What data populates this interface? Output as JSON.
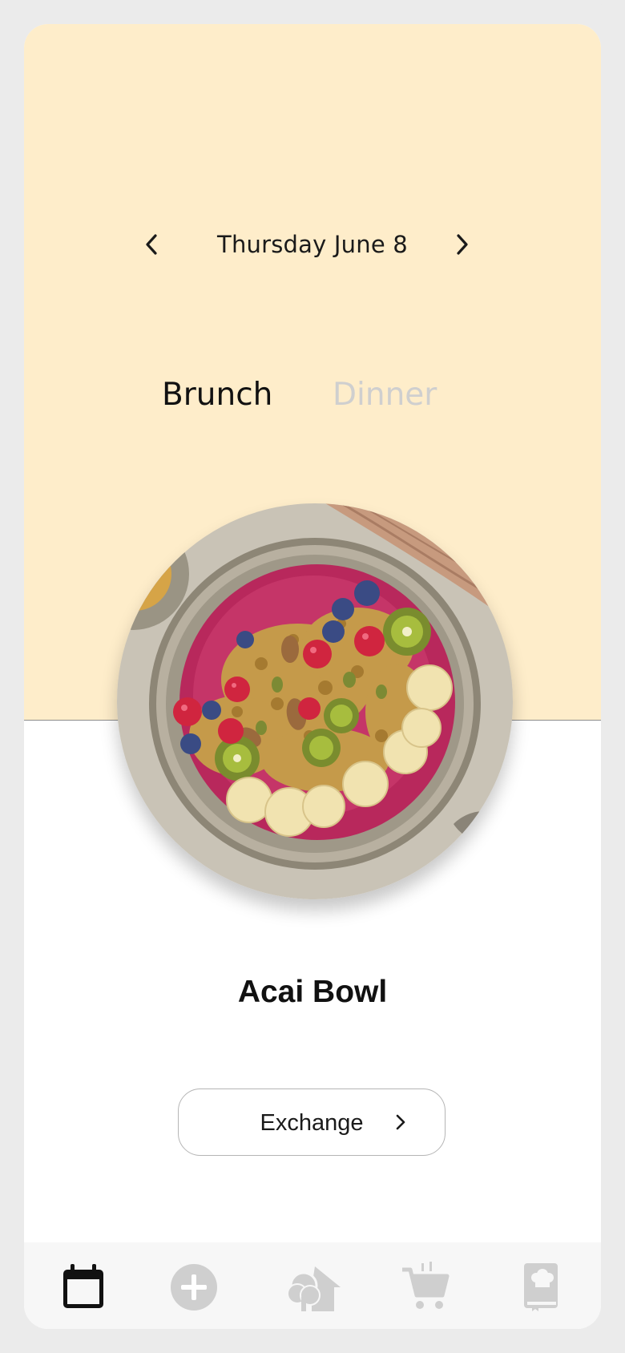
{
  "header": {
    "date_label": "Thursday June 8",
    "prev_icon": "chevron-left-icon",
    "next_icon": "chevron-right-icon"
  },
  "meal_tabs": [
    {
      "label": "Brunch",
      "active": true
    },
    {
      "label": "Dinner",
      "active": false
    }
  ],
  "dish": {
    "name": "Acai Bowl",
    "photo": "acai-bowl-photo"
  },
  "exchange_button": {
    "label": "Exchange",
    "icon": "chevron-right-icon"
  },
  "tab_bar": {
    "items": [
      {
        "icon": "calendar-icon",
        "active": true
      },
      {
        "icon": "add-circle-icon",
        "active": false
      },
      {
        "icon": "tree-house-icon",
        "active": false
      },
      {
        "icon": "shopping-cart-icon",
        "active": false
      },
      {
        "icon": "recipe-book-icon",
        "active": false
      }
    ]
  },
  "colors": {
    "top_panel": "#feedca",
    "frame": "#ebebeb",
    "tab_bar": "#f7f7f7",
    "active_icon": "#111111",
    "inactive_icon": "#cfcfcf"
  }
}
